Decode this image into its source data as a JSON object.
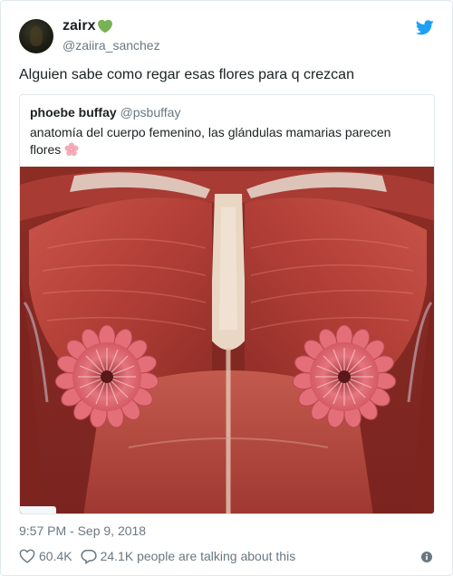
{
  "author": {
    "display_name": "zairx",
    "name_emoji": "green-heart-icon",
    "handle": "@zaiira_sanchez"
  },
  "tweet": {
    "text": "Alguien sabe como regar esas flores para q crezcan",
    "timestamp": "9:57 PM - Sep 9, 2018"
  },
  "quoted_tweet": {
    "display_name": "phoebe buffay",
    "handle": "@psbuffay",
    "text_line1": "anatomía del cuerpo femenino, las glándulas mamarias parecen",
    "text_line2": "flores",
    "emoji": "cherry-blossom-icon"
  },
  "actions": {
    "likes": "60.4K",
    "conversation": "24.1K people are talking about this"
  },
  "colors": {
    "twitter_blue": "#1da1f2",
    "secondary_text": "#697882",
    "primary_text": "#1c2022",
    "border": "#e1e8ed",
    "green_heart": "#77b255"
  }
}
